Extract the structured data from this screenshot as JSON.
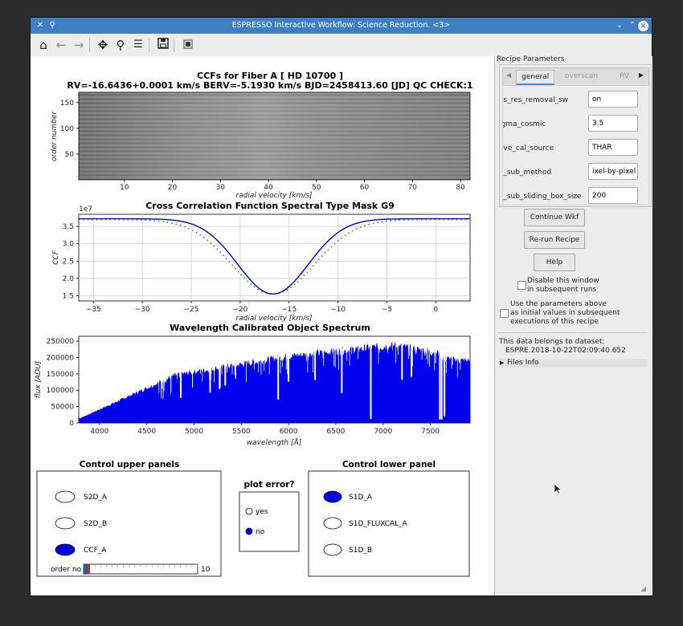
{
  "window": {
    "title": "ESPRESSO Interactive Workflow: Science Reduction. <3>"
  },
  "toolbar": {
    "icons": [
      "home-icon",
      "back-icon",
      "forward-icon",
      "pan-icon",
      "zoom-icon",
      "configure-icon",
      "save-icon",
      "toggle-icon"
    ]
  },
  "plot_top": {
    "title1": "CCFs for Fiber A  [ HD 10700 ]",
    "title2": "RV=-16.6436+0.0001 km/s BERV=-5.1930 km/s BJD=2458413.60 [JD] QC CHECK:1",
    "ylabel": "order number",
    "xlabel": "radial velocity [km/s]",
    "xticks": [
      "10",
      "20",
      "30",
      "40",
      "50",
      "60",
      "70",
      "80"
    ],
    "yticks": [
      "150",
      "100",
      "50"
    ]
  },
  "plot_mid": {
    "title": "Cross Correlation Function Spectral Type Mask G9",
    "ylabel": "CCF",
    "xlabel": "radial velocity [km/s]",
    "offset": "1e7",
    "xticks": [
      "−35",
      "−30",
      "−25",
      "−20",
      "−15",
      "−10",
      "−5",
      "0"
    ],
    "yticks": [
      "3.5",
      "3.0",
      "2.5",
      "2.0",
      "1.5"
    ]
  },
  "plot_low": {
    "title": "Wavelength Calibrated Object Spectrum",
    "ylabel": "flux [ADU]",
    "xlabel": "wavelength [Å]",
    "xticks": [
      "4000",
      "4500",
      "5000",
      "5500",
      "6000",
      "6500",
      "7000",
      "7500"
    ],
    "yticks": [
      "250000",
      "200000",
      "150000",
      "100000",
      "50000",
      "0"
    ]
  },
  "controls": {
    "upper_title": "Control upper panels",
    "upper_options": [
      "S2D_A",
      "S2D_B",
      "CCF_A"
    ],
    "upper_selected": "CCF_A",
    "slider_label": "order no",
    "slider_max": "10",
    "error_title": "plot error?",
    "error_options": [
      "yes",
      "no"
    ],
    "error_selected": "no",
    "lower_title": "Control lower panel",
    "lower_options": [
      "S1D_A",
      "S1D_FLUXCAL_A",
      "S1D_B"
    ],
    "lower_selected": "S1D_A"
  },
  "recipe": {
    "group_title": "Recipe Parameters",
    "tabs": [
      "general",
      "overscan",
      "RV"
    ],
    "active_tab": "general",
    "params": [
      {
        "name": "as_res_removal_sw",
        "value": "on"
      },
      {
        "name": "igma_cosmic",
        "value": "3.5"
      },
      {
        "name": "ave_cal_source",
        "value": "THAR"
      },
      {
        "name": "y_sub_method",
        "value": "ixel-by-pixel"
      },
      {
        "name": "y_sub_sliding_box_size",
        "value": "200"
      }
    ],
    "continue_label": "Continue Wkf",
    "rerun_label": "Re-run Recipe",
    "help_label": "Help",
    "disable_text1": "Disable this window",
    "disable_text2": "in subsequent runs",
    "use_params_1": "Use the parameters above",
    "use_params_2": "as initial values in subsequent",
    "use_params_3": "executions of this recipe",
    "dataset_label": "This data belongs to dataset:",
    "dataset_name": "ESPRE.2018-10-22T02:09:40.652",
    "files_info": "Files Info"
  },
  "colors": {
    "titlebar": "#3e7fc4",
    "series": "#0000dd",
    "accent": "#4a8bd4"
  }
}
